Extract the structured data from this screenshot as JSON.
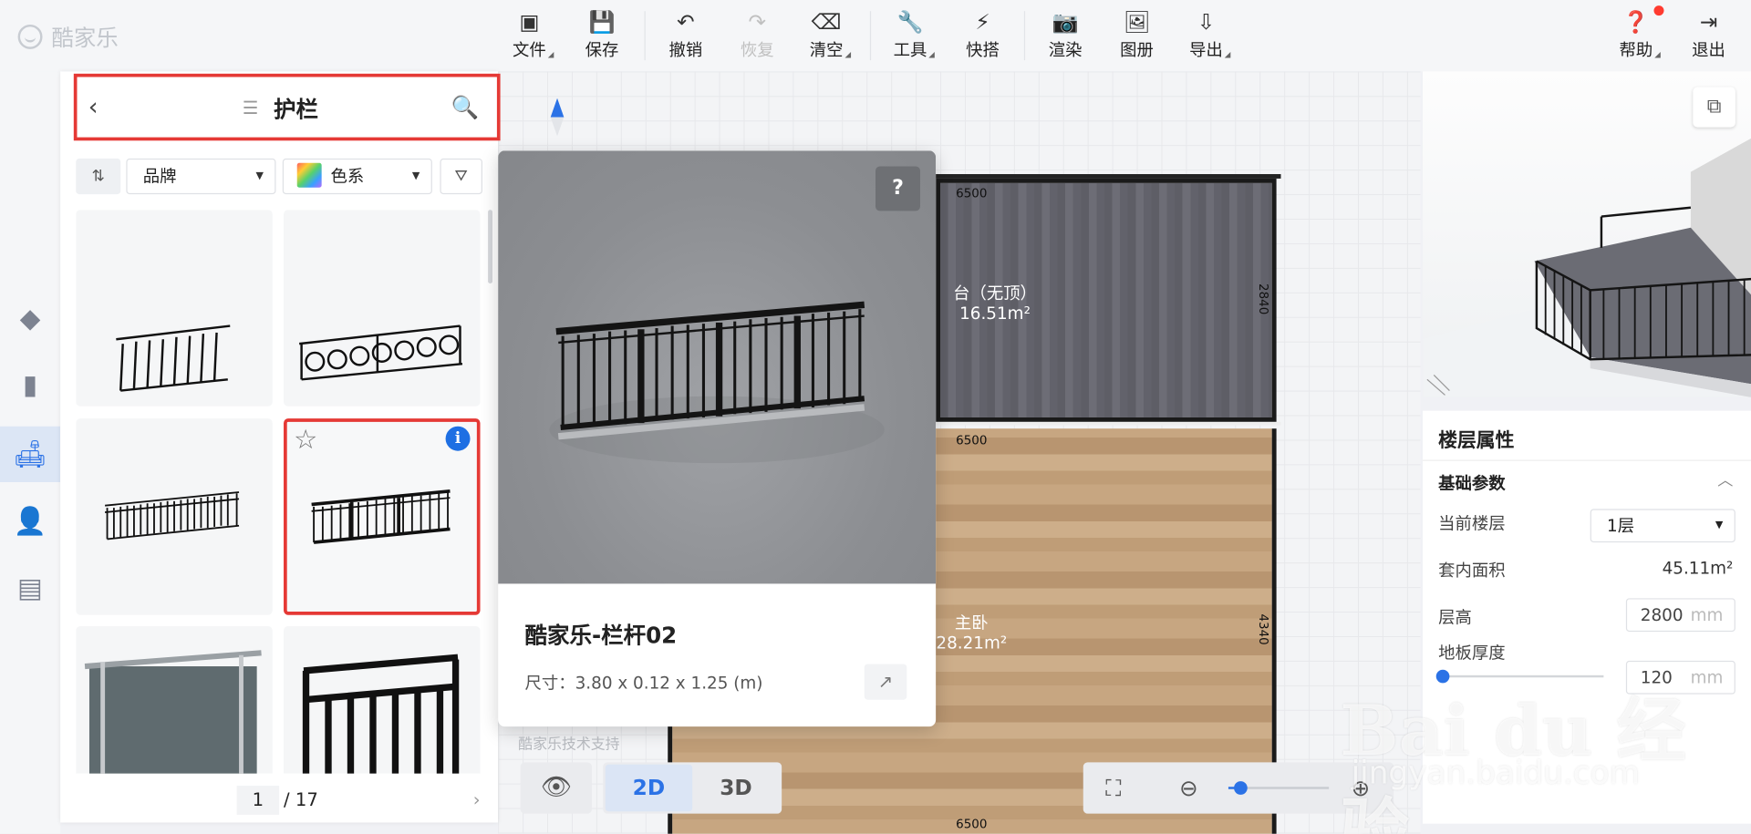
{
  "app": {
    "logo_text": "酷家乐"
  },
  "toolbar": {
    "file": "文件",
    "save": "保存",
    "undo": "撤销",
    "redo": "恢复",
    "clear": "清空",
    "tools": "工具",
    "quick": "快搭",
    "render": "渲染",
    "album": "图册",
    "export": "导出",
    "help": "帮助",
    "exit": "退出"
  },
  "panel": {
    "title": "护栏",
    "brand_filter": "品牌",
    "color_filter": "色系",
    "page_current": "1",
    "page_total": "/ 17"
  },
  "preview": {
    "title": "酷家乐-栏杆02",
    "size": "尺寸：3.80 x 0.12 x 1.25 (m)",
    "help_icon": "?",
    "support": "酷家乐技术支持"
  },
  "plan": {
    "dims": {
      "top": "6500",
      "mid": "6500",
      "bottom": "6500",
      "right_top": "2840",
      "right_bottom": "4340"
    },
    "balcony_name": "台（无顶）",
    "balcony_area": "16.51m²",
    "bedroom_name": "主卧",
    "bedroom_area": "28.21m²"
  },
  "view": {
    "two_d": "2D",
    "three_d": "3D"
  },
  "properties": {
    "title": "楼层属性",
    "section": "基础参数",
    "current_floor_label": "当前楼层",
    "current_floor_value": "1层",
    "inner_area_label": "套内面积",
    "inner_area_value": "45.11m²",
    "floor_height_label": "层高",
    "floor_height_value": "2800",
    "floor_height_unit": "mm",
    "slab_label": "地板厚度",
    "slab_value": "120",
    "slab_unit": "mm"
  },
  "watermark": {
    "main": "Bai du 经验",
    "sub": "jingyan.baidu.com"
  },
  "zoom_level": 0.12,
  "colors": {
    "accent": "#2b72e6",
    "highlight": "#e53935"
  }
}
